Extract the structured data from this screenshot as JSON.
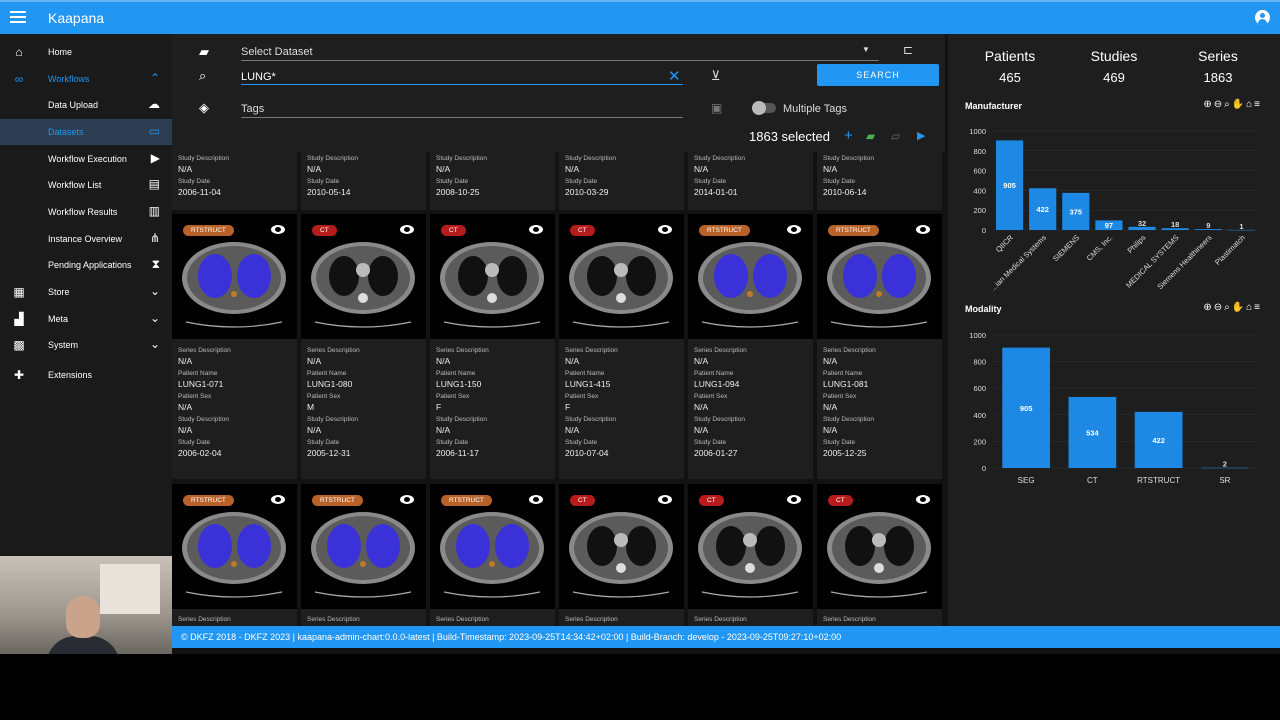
{
  "app": {
    "title": "Kaapana"
  },
  "sidebar": {
    "items": [
      {
        "label": "Home",
        "icon": "home-icon",
        "trail": ""
      },
      {
        "label": "Workflows",
        "icon": "workflows-icon",
        "trail": "^"
      },
      {
        "label": "Data Upload",
        "icon": "",
        "trail": "upload-icon"
      },
      {
        "label": "Datasets",
        "icon": "",
        "trail": "datasets-icon"
      },
      {
        "label": "Workflow Execution",
        "icon": "",
        "trail": "play-icon"
      },
      {
        "label": "Workflow List",
        "icon": "",
        "trail": "clipboard-icon"
      },
      {
        "label": "Workflow Results",
        "icon": "",
        "trail": "bar-chart-icon"
      },
      {
        "label": "Instance Overview",
        "icon": "",
        "trail": "network-icon"
      },
      {
        "label": "Pending Applications",
        "icon": "",
        "trail": "hourglass-icon"
      },
      {
        "label": "Store",
        "icon": "store-icon",
        "trail": "v"
      },
      {
        "label": "Meta",
        "icon": "meta-icon",
        "trail": "v"
      },
      {
        "label": "System",
        "icon": "system-icon",
        "trail": "v"
      },
      {
        "label": "Extensions",
        "icon": "puzzle-icon",
        "trail": ""
      }
    ]
  },
  "filters": {
    "dataset_placeholder": "Select Dataset",
    "search_value": "LUNG*",
    "search_button": "SEARCH",
    "tags_placeholder": "Tags",
    "multiple_tags_label": "Multiple Tags",
    "selected_count": "1863 selected"
  },
  "labels": {
    "study_description": "Study Description",
    "study_date": "Study Date",
    "series_description": "Series Description",
    "patient_name": "Patient Name",
    "patient_sex": "Patient Sex"
  },
  "top_row": [
    {
      "study_description": "N/A",
      "study_date": "2006-11-04"
    },
    {
      "study_description": "N/A",
      "study_date": "2010-05-14"
    },
    {
      "study_description": "N/A",
      "study_date": "2008-10-25"
    },
    {
      "study_description": "N/A",
      "study_date": "2010-03-29"
    },
    {
      "study_description": "N/A",
      "study_date": "2014-01-01"
    },
    {
      "study_description": "N/A",
      "study_date": "2010-06-14"
    }
  ],
  "middle_row": [
    {
      "modality": "RTSTRUCT",
      "series_description": "N/A",
      "patient_name": "LUNG1-071",
      "patient_sex": "N/A",
      "study_description": "N/A",
      "study_date": "2006-02-04"
    },
    {
      "modality": "CT",
      "series_description": "N/A",
      "patient_name": "LUNG1-080",
      "patient_sex": "M",
      "study_description": "N/A",
      "study_date": "2005-12-31"
    },
    {
      "modality": "CT",
      "series_description": "N/A",
      "patient_name": "LUNG1-150",
      "patient_sex": "F",
      "study_description": "N/A",
      "study_date": "2006-11-17"
    },
    {
      "modality": "CT",
      "series_description": "N/A",
      "patient_name": "LUNG1-415",
      "patient_sex": "F",
      "study_description": "N/A",
      "study_date": "2010-07-04"
    },
    {
      "modality": "RTSTRUCT",
      "series_description": "N/A",
      "patient_name": "LUNG1-094",
      "patient_sex": "N/A",
      "study_description": "N/A",
      "study_date": "2006-01-27"
    },
    {
      "modality": "RTSTRUCT",
      "series_description": "N/A",
      "patient_name": "LUNG1-081",
      "patient_sex": "N/A",
      "study_description": "N/A",
      "study_date": "2005-12-25"
    }
  ],
  "bottom_row": [
    {
      "modality": "RTSTRUCT"
    },
    {
      "modality": "RTSTRUCT"
    },
    {
      "modality": "RTSTRUCT"
    },
    {
      "modality": "CT"
    },
    {
      "modality": "CT"
    },
    {
      "modality": "CT"
    }
  ],
  "stats": [
    {
      "label": "Patients",
      "value": "465"
    },
    {
      "label": "Studies",
      "value": "469"
    },
    {
      "label": "Series",
      "value": "1863"
    }
  ],
  "footer": "© DKFZ 2018 - DKFZ 2023 | kaapana-admin-chart:0.0.0-latest | Build-Timestamp: 2023-09-25T14:34:42+02:00 | Build-Branch: develop - 2023-09-25T09:27:10+02:00",
  "colors": {
    "accent": "#2196f3",
    "bar": "#1e88e5",
    "rtstruct": "#b8622a",
    "ct": "#b71c1c"
  },
  "chart_data": [
    {
      "type": "bar",
      "title": "Manufacturer",
      "categories": [
        "QIICR",
        "...ian Medical Systems",
        "SIEMENS",
        "CMS, Inc.",
        "Philips",
        "MEDICAL SYSTEMS",
        "Siemens Healthineers",
        "Plastimatch"
      ],
      "values": [
        905,
        422,
        375,
        97,
        32,
        18,
        9,
        1
      ],
      "ylim": [
        0,
        1000
      ],
      "yticks": [
        "1000",
        "800",
        "600",
        "400",
        "200",
        "0"
      ]
    },
    {
      "type": "bar",
      "title": "Modality",
      "categories": [
        "SEG",
        "CT",
        "RTSTRUCT",
        "SR"
      ],
      "values": [
        905,
        534,
        422,
        2
      ],
      "ylim": [
        0,
        1000
      ],
      "yticks": [
        "1000",
        "800",
        "600",
        "400",
        "200",
        "0"
      ]
    }
  ]
}
